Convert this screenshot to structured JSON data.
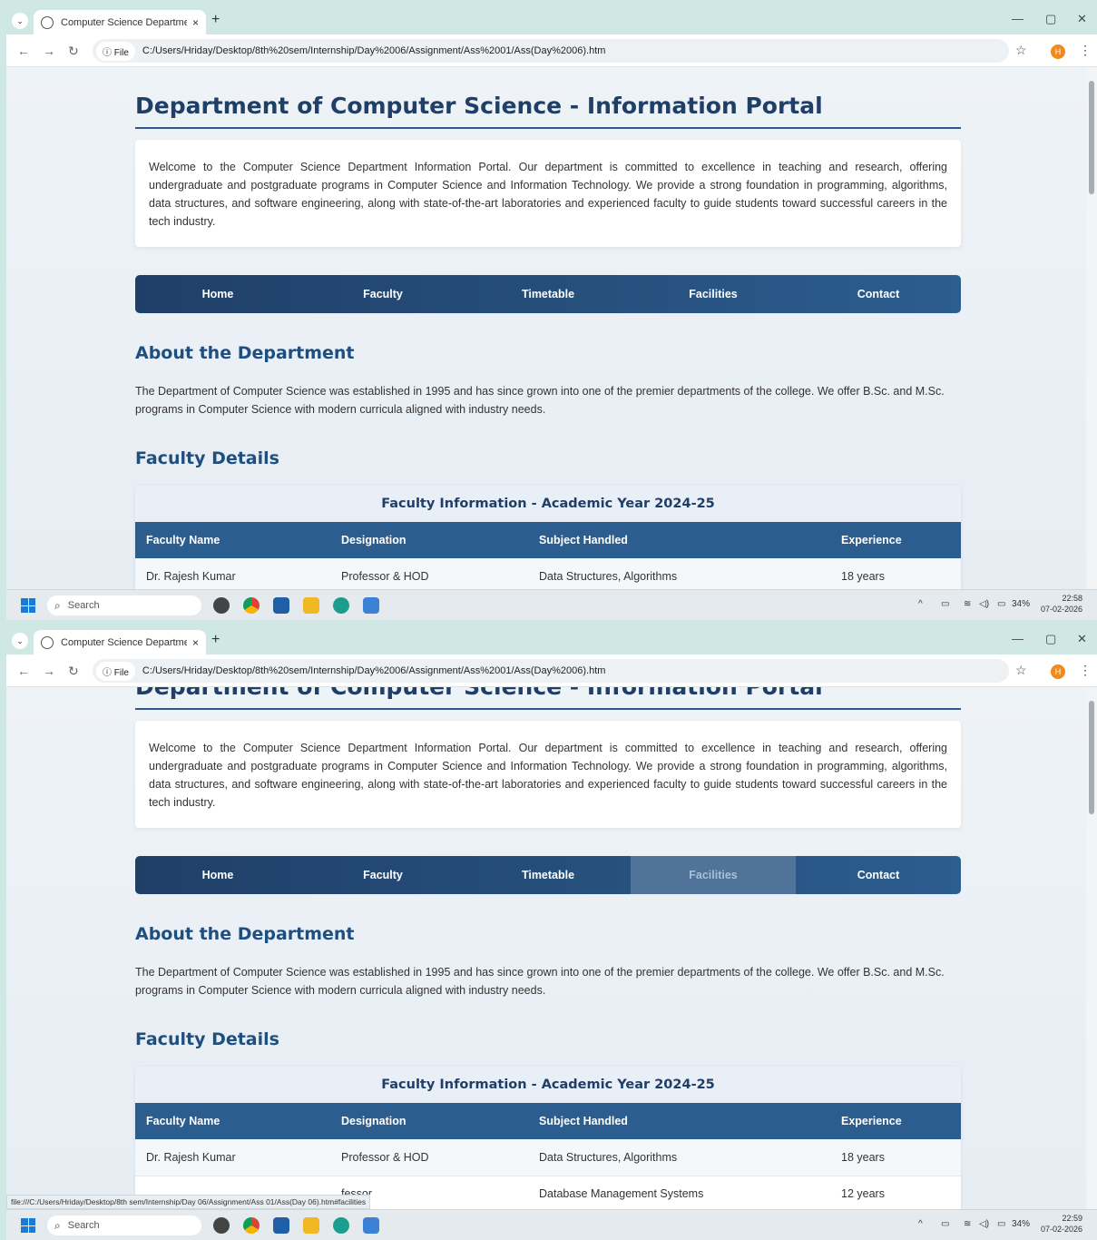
{
  "browser": {
    "tab_title": "Computer Science Department",
    "tab_close": "×",
    "new_tab": "+",
    "menu_chevron": "⌄",
    "chip_label": "File",
    "url": "C:/Users/Hriday/Desktop/8th%20sem/Internship/Day%2006/Assignment/Ass%2001/Ass(Day%2006).htm",
    "profile_initial": "H",
    "status_url": "file:///C:/Users/Hriday/Desktop/8th sem/Internship/Day 06/Assignment/Ass 01/Ass(Day 06).htm#facilities",
    "icons": [
      "chevron-down-icon",
      "globe-icon",
      "back-icon",
      "forward-icon",
      "reload-icon",
      "info-icon",
      "star-icon",
      "kebab-menu-icon",
      "minimize-icon",
      "restore-icon",
      "close-icon"
    ]
  },
  "page": {
    "title": "Department of Computer Science - Information Portal",
    "welcome": "Welcome to the Computer Science Department Information Portal. Our department is committed to excellence in teaching and research, offering undergraduate and postgraduate programs in Computer Science and Information Technology. We provide a strong foundation in programming, algorithms, data structures, and software engineering, along with state-of-the-art laboratories and experienced faculty to guide students toward successful careers in the tech industry.",
    "nav": [
      "Home",
      "Faculty",
      "Timetable",
      "Facilities",
      "Contact"
    ],
    "about_heading": "About the Department",
    "about_text": "The Department of Computer Science was established in 1995 and has since grown into one of the premier departments of the college. We offer B.Sc. and M.Sc. programs in Computer Science with modern curricula aligned with industry needs.",
    "faculty_heading": "Faculty Details",
    "table": {
      "caption": "Faculty Information - Academic Year 2024-25",
      "headers": [
        "Faculty Name",
        "Designation",
        "Subject Handled",
        "Experience"
      ],
      "rows": [
        [
          "Dr. Rajesh Kumar",
          "Professor & HOD",
          "Data Structures, Algorithms",
          "18 years"
        ],
        [
          "",
          "fessor",
          "Database Management Systems",
          "12 years"
        ]
      ]
    }
  },
  "taskbar": {
    "search_placeholder": "Search",
    "battery": "34%",
    "shot1_time": "22:58",
    "shot2_time": "22:59",
    "date": "07-02-2026"
  },
  "colors": {
    "title": "#1f3f67",
    "nav_start": "#1f3f67",
    "nav_end": "#2c5d8f",
    "nav_hover": "#4f7399",
    "table_header": "#2c5d8f",
    "tab_strip": "#cfe8e3"
  },
  "state": {
    "shot2_hovered_nav": "Facilities",
    "shot2_scrolled": true
  }
}
